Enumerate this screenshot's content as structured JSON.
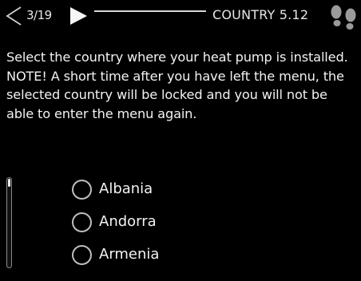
{
  "header": {
    "page_counter": "3/19",
    "menu_title": "COUNTRY 5.12"
  },
  "description": "Select the country where your heat pump is installed. NOTE! A short time after you have left the menu, the selected country will be locked and you will not be able to enter the menu again.",
  "countries": [
    {
      "label": "Albania",
      "selected": false
    },
    {
      "label": "Andorra",
      "selected": false
    },
    {
      "label": "Armenia",
      "selected": false
    }
  ],
  "icons": {
    "prev": "chevron-left-icon",
    "next": "play-right-icon",
    "help": "footsteps-icon"
  },
  "colors": {
    "background": "#000000",
    "text": "#f2f2f2"
  }
}
